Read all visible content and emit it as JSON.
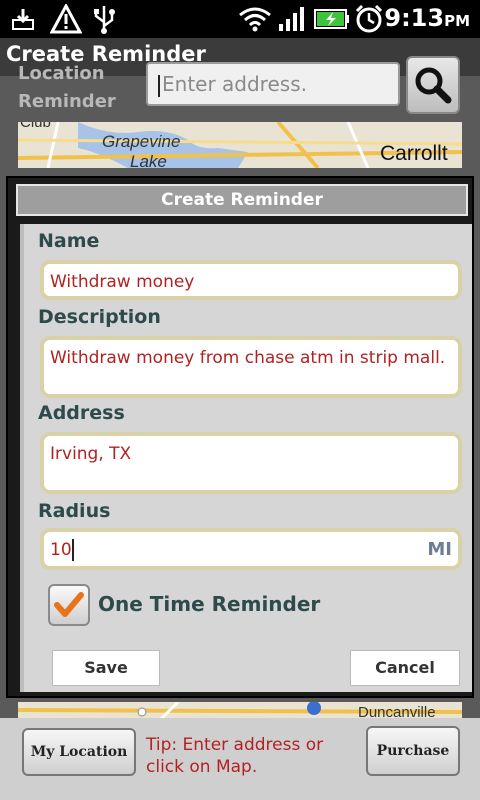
{
  "status_bar": {
    "time": "9:13",
    "ampm": "PM",
    "icons": [
      "download-icon",
      "warning-icon",
      "usb-icon",
      "wifi-icon",
      "signal-icon",
      "battery-charging-icon",
      "alarm-icon"
    ]
  },
  "activity": {
    "title": "Create Reminder",
    "location_label": "Location Reminder",
    "search": {
      "placeholder": "Enter address."
    },
    "map_top_labels": [
      "Club",
      "Grapevine",
      "Lake",
      "Carrollt"
    ],
    "map_bottom_labels": [
      "Duncanville"
    ],
    "my_location_button": "My Location",
    "tip": "Tip: Enter address or click on Map.",
    "purchase_button": "Purchase"
  },
  "dialog": {
    "title": "Create Reminder",
    "name_label": "Name",
    "name_value": "Withdraw money",
    "description_label": "Description",
    "description_value": "Withdraw money from chase atm in strip mall.",
    "address_label": "Address",
    "address_value": "Irving, TX",
    "radius_label": "Radius",
    "radius_value": "10",
    "radius_unit": "MI",
    "one_time_label": "One Time Reminder",
    "one_time_checked": true,
    "save_button": "Save",
    "cancel_button": "Cancel"
  },
  "colors": {
    "value_text": "#b22222",
    "label_text": "#2f4a4a",
    "check_orange": "#e8741a"
  }
}
